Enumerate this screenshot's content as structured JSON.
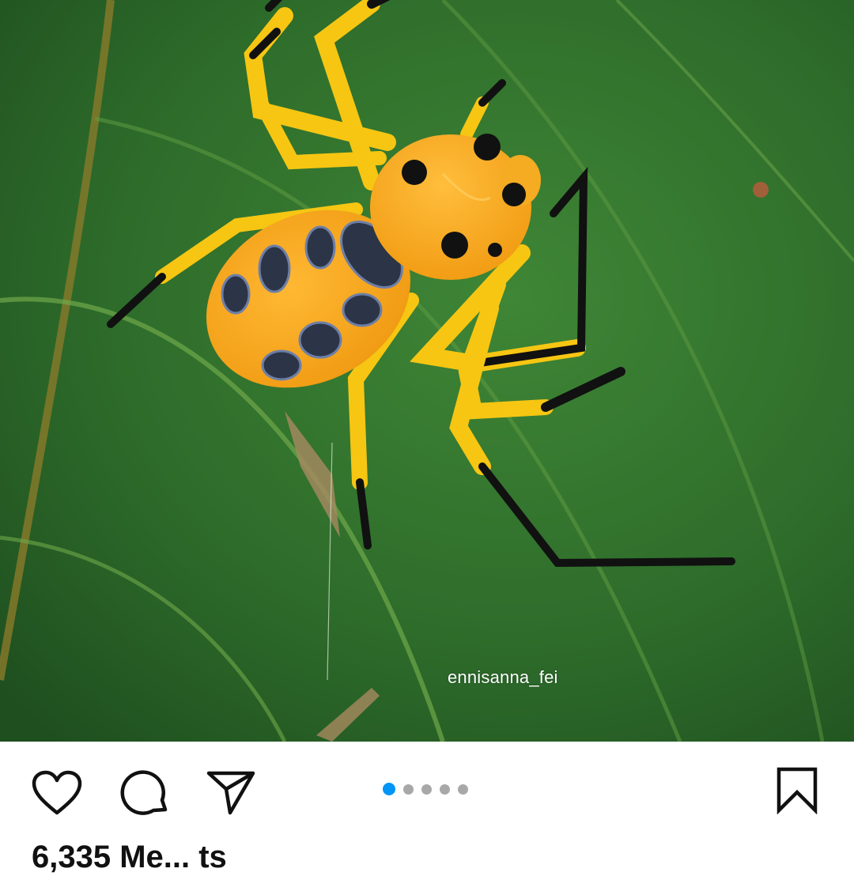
{
  "post": {
    "image_alt": "Yellow spider with black-blue spots on a green leaf",
    "watermark": "ennisanna_fei"
  },
  "actions": {
    "like_icon": "heart-icon",
    "comment_icon": "comment-bubble-icon",
    "share_icon": "paper-plane-icon",
    "save_icon": "bookmark-icon"
  },
  "carousel": {
    "total": 5,
    "active_index": 1
  },
  "likes_text": "6,335 Me... ts",
  "colors": {
    "accent": "#0095f6",
    "inactive_dot": "#a8a8a8",
    "icon": "#111111"
  }
}
